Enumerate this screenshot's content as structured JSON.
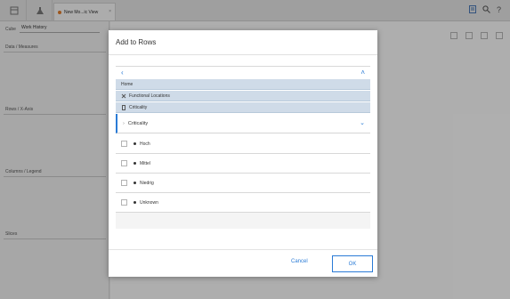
{
  "tab": {
    "title": "New Mo...ic View",
    "close": "×"
  },
  "left_panel": {
    "cube_label": "Cube",
    "cube_value": "Work History",
    "data_measures": "Data / Measures",
    "rows_axis": "Rows / X-Axis",
    "columns_legend": "Columns / Legend",
    "slices": "Slices"
  },
  "dialog": {
    "title": "Add to Rows",
    "breadcrumbs": [
      {
        "label": "Home"
      },
      {
        "label": "Functional Locations"
      },
      {
        "label": "Criticality"
      }
    ],
    "selected_level": "Criticality",
    "items": [
      {
        "label": "Hoch"
      },
      {
        "label": "Mittel"
      },
      {
        "label": "Niedrig"
      },
      {
        "label": "Unknown"
      }
    ],
    "cancel_label": "Cancel",
    "ok_label": "OK"
  },
  "colors": {
    "accent": "#2a7bd6",
    "breadcrumb_bg": "#cfdbe8"
  }
}
